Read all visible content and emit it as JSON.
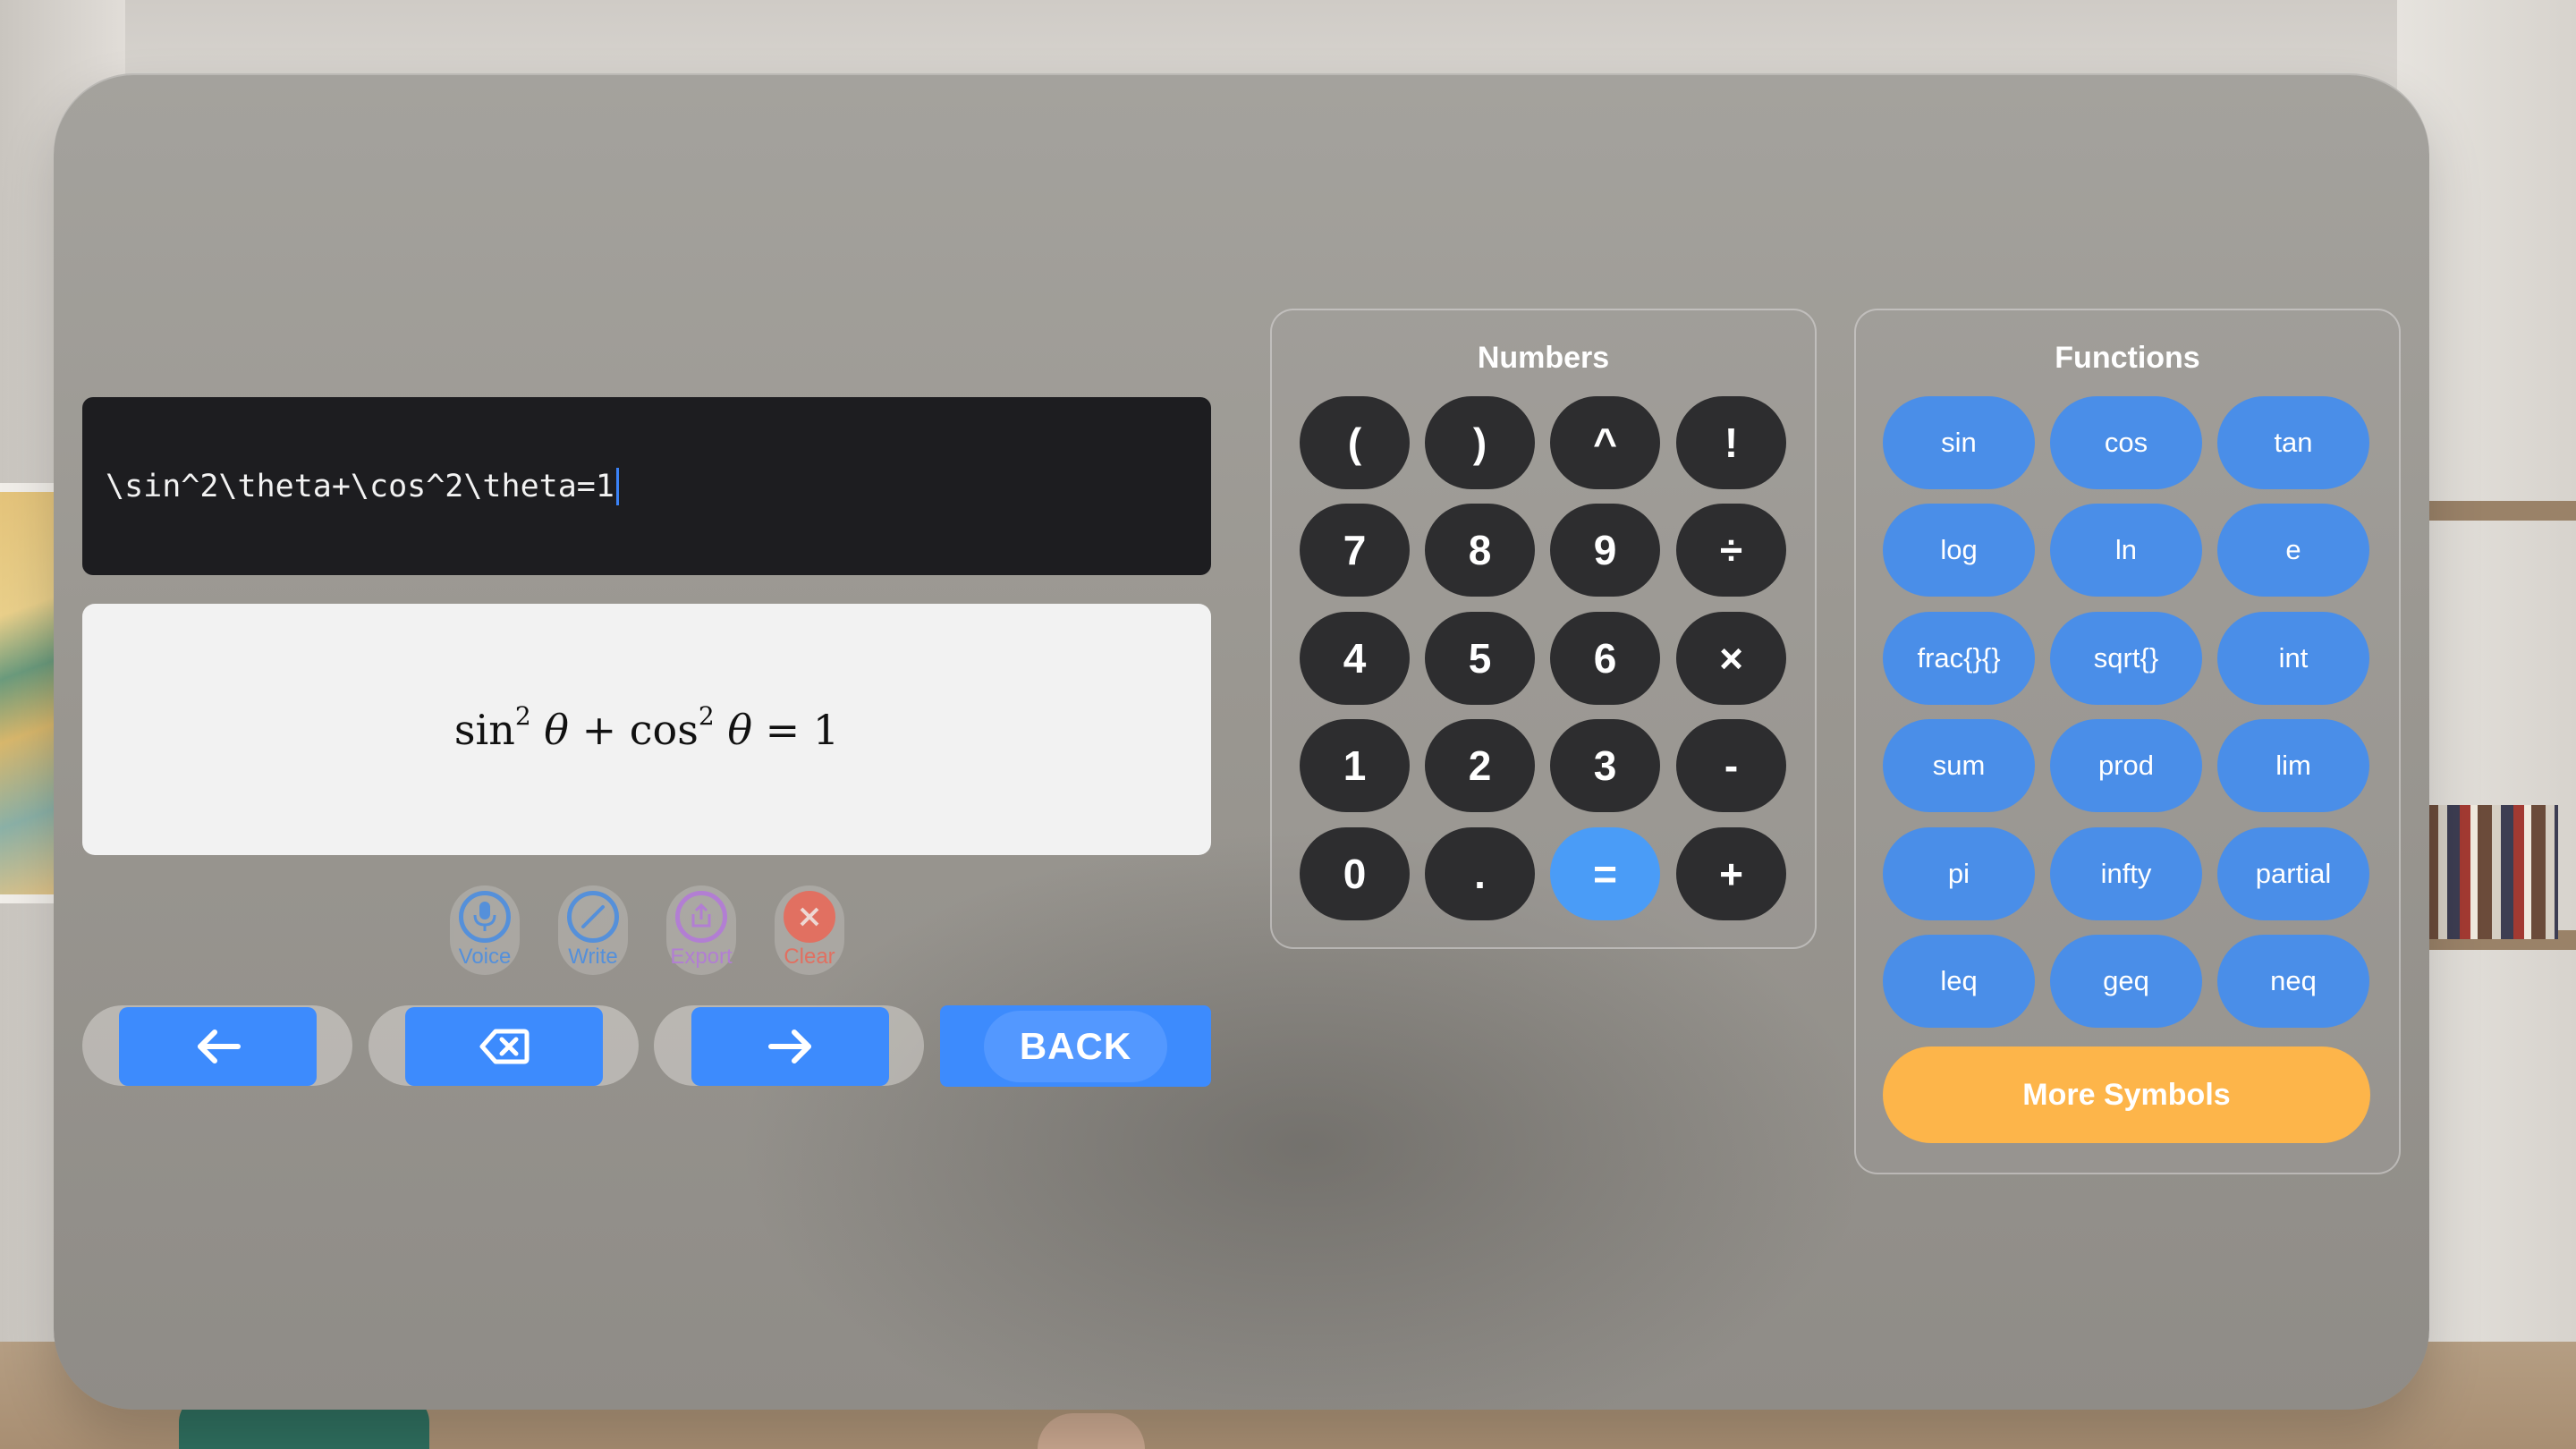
{
  "editor": {
    "latex_input": "\\sin^2\\theta+\\cos^2\\theta=1",
    "preview": {
      "sin": "sin",
      "cos": "cos",
      "exp": "2",
      "theta": "θ",
      "plus": "+",
      "eq": "=",
      "rhs": "1"
    }
  },
  "tools": {
    "voice": "Voice",
    "write": "Write",
    "export": "Export",
    "clear": "Clear"
  },
  "navigation": {
    "back_label": "BACK"
  },
  "numbers": {
    "title": "Numbers",
    "keys": [
      "(",
      ")",
      "^",
      "!",
      "7",
      "8",
      "9",
      "÷",
      "4",
      "5",
      "6",
      "×",
      "1",
      "2",
      "3",
      "-",
      "0",
      ".",
      "=",
      "+"
    ]
  },
  "functions": {
    "title": "Functions",
    "keys": [
      "sin",
      "cos",
      "tan",
      "log",
      "ln",
      "e",
      "frac{}{}",
      "sqrt{}",
      "int",
      "sum",
      "prod",
      "lim",
      "pi",
      "infty",
      "partial",
      "leq",
      "geq",
      "neq"
    ],
    "more_label": "More Symbols"
  },
  "colors": {
    "accent": "#3d8bfd",
    "equals_key": "#4a9cf7",
    "function_key": "#4a8ee8",
    "more_symbols": "#fdb54a",
    "dark_key": "#2d2d2f",
    "input_bg": "#1d1d20"
  }
}
